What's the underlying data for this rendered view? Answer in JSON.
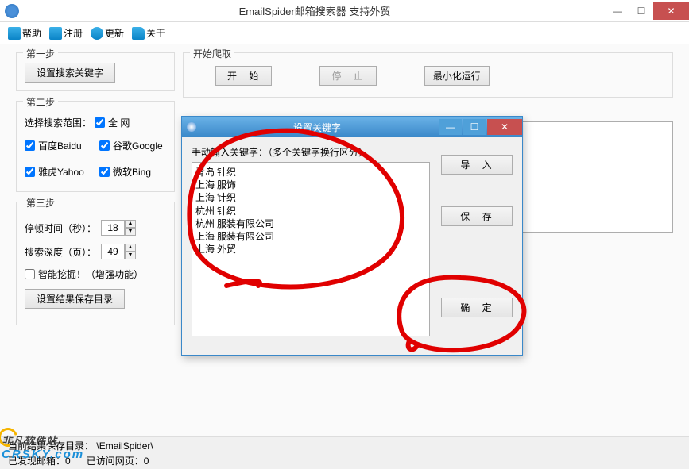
{
  "window": {
    "title": "EmailSpider邮箱搜索器 支持外贸"
  },
  "toolbar": {
    "help": "帮助",
    "register": "注册",
    "update": "更新",
    "about": "关于"
  },
  "step1": {
    "title": "第一步",
    "btn": "设置搜索关键字"
  },
  "crawl": {
    "title": "开始爬取",
    "start": "开 始",
    "stop": "停 止",
    "minimize": "最小化运行"
  },
  "step2": {
    "title": "第二步",
    "scope_label": "选择搜索范围：",
    "all": "全  网",
    "baidu": "百度Baidu",
    "google": "谷歌Google",
    "yahoo": "雅虎Yahoo",
    "bing": "微软Bing"
  },
  "step3": {
    "title": "第三步",
    "pause_label": "停顿时间（秒）：",
    "pause_value": "18",
    "depth_label": "搜索深度（页）：",
    "depth_value": "49",
    "smart": "智能挖掘！（增强功能）",
    "save_dir": "设置结果保存目录"
  },
  "status": {
    "path_label": "当前结果保存目录：",
    "path": "\\EmailSpider\\",
    "found_label": "已发现邮箱：",
    "found": "0",
    "visited_label": "已访问网页：",
    "visited": "0"
  },
  "dialog": {
    "title": "设置关键字",
    "label": "手动输入关键字：（多个关键字换行区分）",
    "textarea": "青岛 针织\n上海 服饰\n上海 针织\n杭州 针织\n杭州 服装有限公司\n上海 服装有限公司\n上海 外贸",
    "import": "导 入",
    "save": "保 存",
    "ok": "确 定"
  },
  "watermark": {
    "line1": "非凡软件站",
    "line2": "CRSKY.com"
  }
}
